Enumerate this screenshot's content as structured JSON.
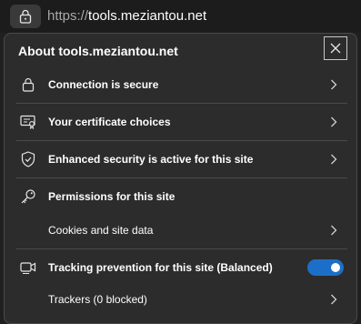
{
  "address_bar": {
    "url_scheme": "https://",
    "url_host": "tools.meziantou.net",
    "lock_icon": "lock-icon"
  },
  "panel": {
    "title": "About tools.meziantou.net",
    "close_icon": "close-icon",
    "items": [
      {
        "label": "Connection is secure",
        "icon": "lock-icon",
        "has_chevron": true
      },
      {
        "label": "Your certificate choices",
        "icon": "certificate-icon",
        "has_chevron": true
      },
      {
        "label": "Enhanced security is active for this site",
        "icon": "shield-icon",
        "has_chevron": true
      },
      {
        "label": "Permissions for this site",
        "icon": "key-icon",
        "has_chevron": false
      },
      {
        "label": "Cookies and site data",
        "icon": "",
        "has_chevron": true
      },
      {
        "label": "Tracking prevention for this site (Balanced)",
        "icon": "tracking-icon",
        "has_toggle": true,
        "toggle_on": true
      },
      {
        "label": "Trackers (0 blocked)",
        "icon": "",
        "has_chevron": true
      }
    ]
  },
  "colors": {
    "accent": "#1c6fc9",
    "panel_bg": "#2c2c2c",
    "separator": "#4a4a4a"
  }
}
